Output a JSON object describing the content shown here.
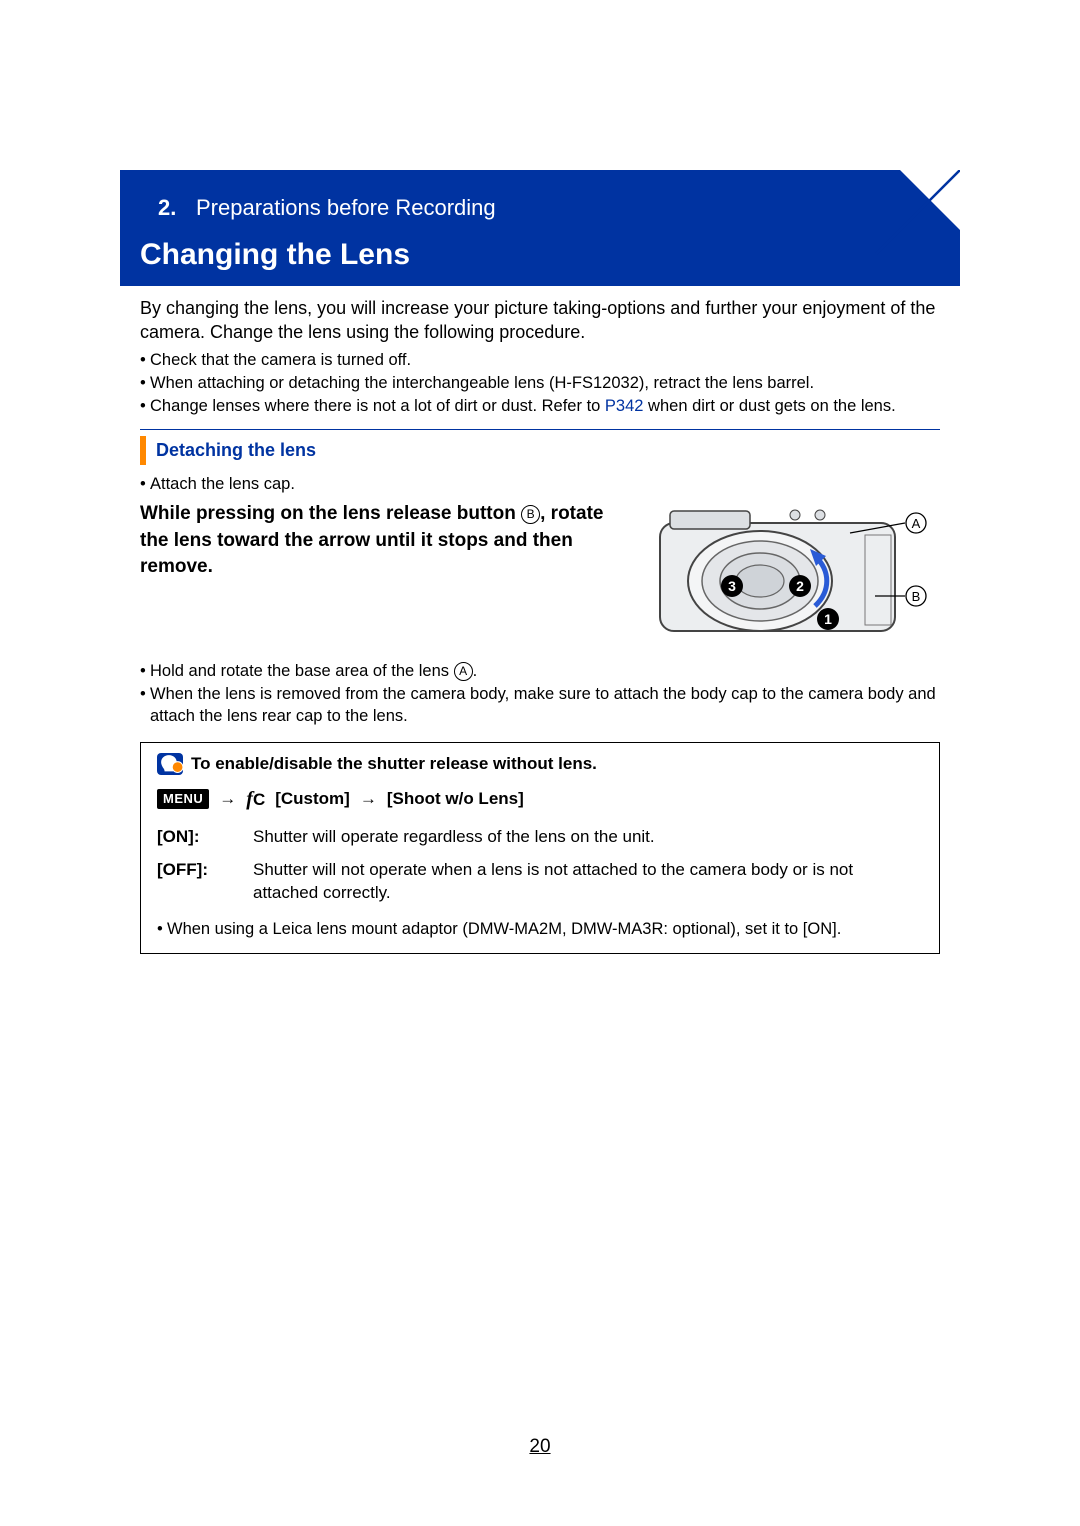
{
  "sidebar": {
    "items": [
      {
        "name": "home"
      },
      {
        "name": "contents"
      },
      {
        "name": "back"
      }
    ]
  },
  "chapter": {
    "number": "2.",
    "title": "Preparations before Recording"
  },
  "section_title": "Changing the Lens",
  "intro": "By changing the lens, you will increase your picture taking-options and further your enjoyment of the camera. Change the lens using the following procedure.",
  "pre_bullets": [
    "Check that the camera is turned off.",
    "When attaching or detaching the interchangeable lens (H-FS12032), retract the lens barrel."
  ],
  "dust_bullet_prefix": "Change lenses where there is not a lot of dirt or dust. Refer to ",
  "dust_link": "P342",
  "dust_bullet_suffix": " when dirt or dust gets on the lens.",
  "sub_heading": "Detaching the lens",
  "sub_bullets": [
    "Attach the lens cap."
  ],
  "instruction_prefix": "While pressing on the lens release button ",
  "instruction_mid": ", rotate the lens toward the arrow until it stops and then remove.",
  "label_A": "A",
  "label_B": "B",
  "after_bullets_1_prefix": "Hold and rotate the base area of the lens ",
  "after_bullets_1_suffix": ".",
  "after_bullets_2": "When the lens is removed from the camera body, make sure to attach the body cap to the camera body and attach the lens rear cap to the lens.",
  "tip": {
    "title": "To enable/disable the shutter release without lens.",
    "menu_label": "MENU",
    "arrow": "→",
    "custom_prefix": "C",
    "path1": "[Custom]",
    "path2": "[Shoot w/o Lens]",
    "options": [
      {
        "key": "[ON]:",
        "desc": "Shutter will operate regardless of the lens on the unit."
      },
      {
        "key": "[OFF]:",
        "desc": "Shutter will not operate when a lens is not attached to the camera body or is not attached correctly."
      }
    ],
    "note": "When using a Leica lens mount adaptor (DMW-MA2M, DMW-MA3R: optional), set it to [ON]."
  },
  "page_number": "20"
}
